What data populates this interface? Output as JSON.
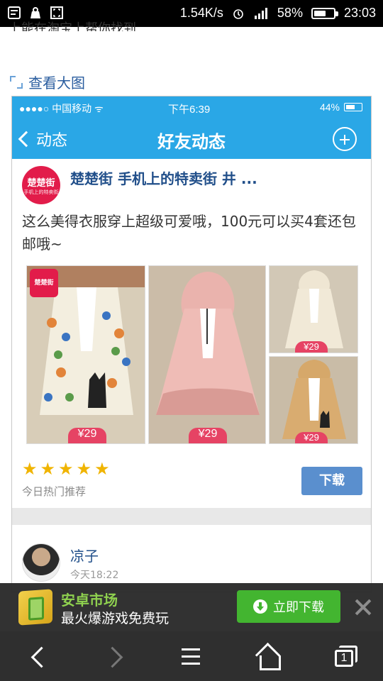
{
  "status_bar": {
    "net_speed": "1.54K/s",
    "battery": "58%",
    "time": "23:03"
  },
  "article": {
    "cut_line": "上能在淘宝上帮你找到",
    "view_large": "查看大图"
  },
  "shot": {
    "carrier": "●●●●○ 中国移动 ᯤ",
    "time": "下午6:39",
    "battery": "44%",
    "back_label": "动态",
    "title": "好友动态",
    "ad_post": {
      "logo_text": "楚楚街",
      "logo_sub": "手机上的特卖街",
      "title": "楚楚街 手机上的特卖街 井 ...",
      "text": "这么美得衣服穿上超级可爱哦，100元可以买4套还包邮哦~",
      "tag_logo": "楚楚街",
      "prices": [
        "¥29",
        "¥29",
        "¥29",
        "¥29"
      ],
      "rating": 5,
      "hot_label": "今日热门推荐",
      "download": "下载"
    },
    "user_post": {
      "name": "凉子",
      "time": "今天18:22"
    }
  },
  "ad_banner": {
    "title": "安卓市场",
    "subtitle": "最火爆游戏免费玩",
    "button": "立即下载"
  },
  "toolbar": {
    "tab_count": "1"
  },
  "colors": {
    "accent_blue": "#2aa7e6",
    "link_blue": "#214f8a",
    "price_pink": "#e64364",
    "ad_green": "#43b530"
  }
}
